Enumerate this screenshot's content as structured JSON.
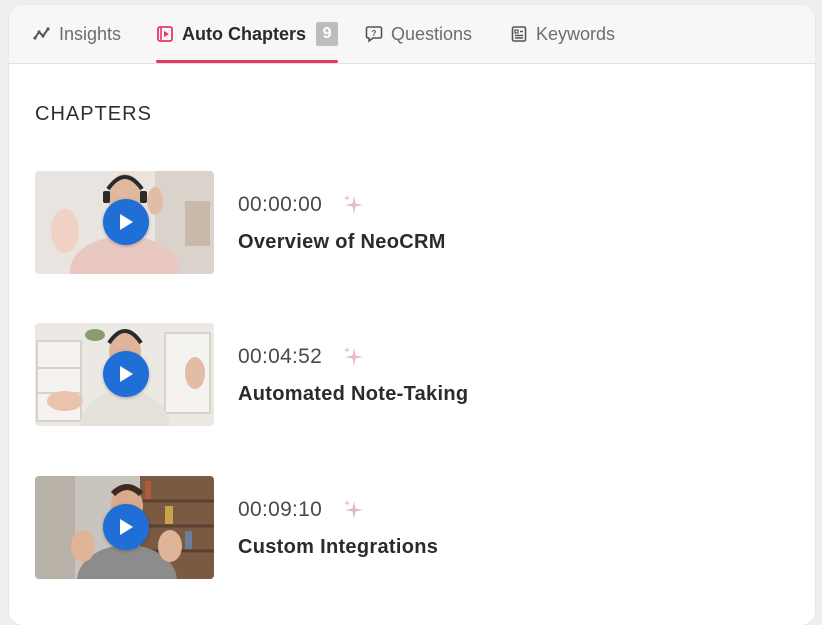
{
  "tabs": [
    {
      "label": "Insights",
      "icon": "insights-chart-icon",
      "active": false
    },
    {
      "label": "Auto Chapters",
      "icon": "video-chapters-icon",
      "active": true,
      "badge": "9"
    },
    {
      "label": "Questions",
      "icon": "question-bubble-icon",
      "active": false
    },
    {
      "label": "Keywords",
      "icon": "keywords-document-icon",
      "active": false
    }
  ],
  "section": {
    "title": "CHAPTERS"
  },
  "chapters": [
    {
      "time": "00:00:00",
      "title": "Overview of NeoCRM"
    },
    {
      "time": "00:04:52",
      "title": "Automated Note-Taking"
    },
    {
      "time": "00:09:10",
      "title": "Custom Integrations"
    }
  ],
  "colors": {
    "accent": "#e63864",
    "play": "#1f6fd6",
    "sparkle": "#e8b7c4"
  }
}
